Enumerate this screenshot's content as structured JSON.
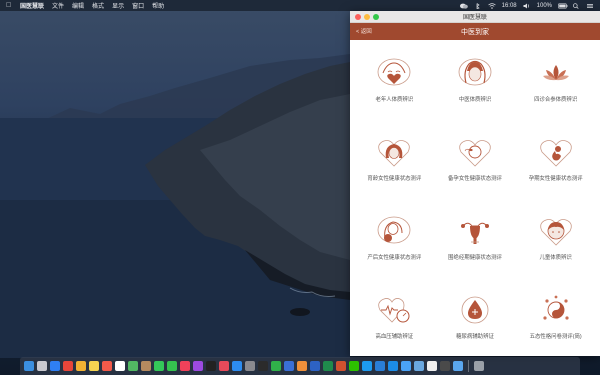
{
  "menubar": {
    "apple_icon": "apple-icon",
    "app_name": "国医慧联",
    "items": [
      "文件",
      "编辑",
      "格式",
      "显示",
      "窗口",
      "帮助"
    ],
    "clock": "16:08",
    "battery": "100%"
  },
  "window": {
    "title": "国医慧联",
    "nav_title": "中医到家",
    "back_label": "< 返回",
    "accent": "#a0492f",
    "icon_color": "#b5553a",
    "items": [
      {
        "label": "老年人体质辨识",
        "icon": "elderly-heart-icon"
      },
      {
        "label": "中医体质辨识",
        "icon": "face-heart-icon"
      },
      {
        "label": "四诊合参体质辨识",
        "icon": "lotus-icon"
      },
      {
        "label": "育龄女性健康状态测评",
        "icon": "woman-heart-icon"
      },
      {
        "label": "备孕女性健康状态测评",
        "icon": "sperm-heart-icon"
      },
      {
        "label": "孕期女性健康状态测评",
        "icon": "fetus-heart-icon"
      },
      {
        "label": "产后女性健康状态测评",
        "icon": "mother-baby-icon"
      },
      {
        "label": "围绝经期健康状态测评",
        "icon": "uterus-icon"
      },
      {
        "label": "儿童体质辨识",
        "icon": "child-heart-icon"
      },
      {
        "label": "高血压辅助辨证",
        "icon": "pressure-heart-icon"
      },
      {
        "label": "糖尿病辅助辨证",
        "icon": "blood-drop-icon"
      },
      {
        "label": "五态性格问卷测评(简)",
        "icon": "yin-yang-icon"
      }
    ]
  },
  "dock": {
    "icons": [
      "finder-icon",
      "launchpad-icon",
      "safari-icon",
      "chrome-icon",
      "photos-icon",
      "notes-icon",
      "calendar-icon",
      "reminders-icon",
      "maps-icon",
      "contacts-icon",
      "messages-icon",
      "facetime-icon",
      "music-icon",
      "podcasts-icon",
      "tv-icon",
      "news-icon",
      "appstore-icon",
      "settings-icon",
      "terminal-icon",
      "numbers-icon",
      "keynote-icon",
      "pages-icon",
      "word-icon",
      "excel-icon",
      "powerpoint-icon",
      "wechat-icon",
      "qq-icon",
      "vscode-icon",
      "xcode-icon",
      "mail-icon",
      "preview-icon",
      "textedit-icon",
      "activity-icon",
      "downloads-icon",
      "trash-icon"
    ],
    "colors": [
      "#3b8fe0",
      "#c9c9cf",
      "#2f7ff3",
      "#e7463a",
      "#f2b233",
      "#f5d451",
      "#f25a4a",
      "#ffffff",
      "#52b863",
      "#b58a5f",
      "#34c759",
      "#35c24f",
      "#f0415a",
      "#9c4ae0",
      "#222222",
      "#e84a5a",
      "#2d8cf0",
      "#8a8a8f",
      "#2b2b2b",
      "#30b14a",
      "#3a6fd6",
      "#f0903a",
      "#2d62c4",
      "#1f8b4c",
      "#d0512f",
      "#2dc100",
      "#1d9bf0",
      "#2a7ed6",
      "#1c8de8",
      "#4aa3f7",
      "#6aa8e0",
      "#efefef",
      "#4a4a4a",
      "#5aa7f0",
      "#9aa0a8"
    ]
  }
}
